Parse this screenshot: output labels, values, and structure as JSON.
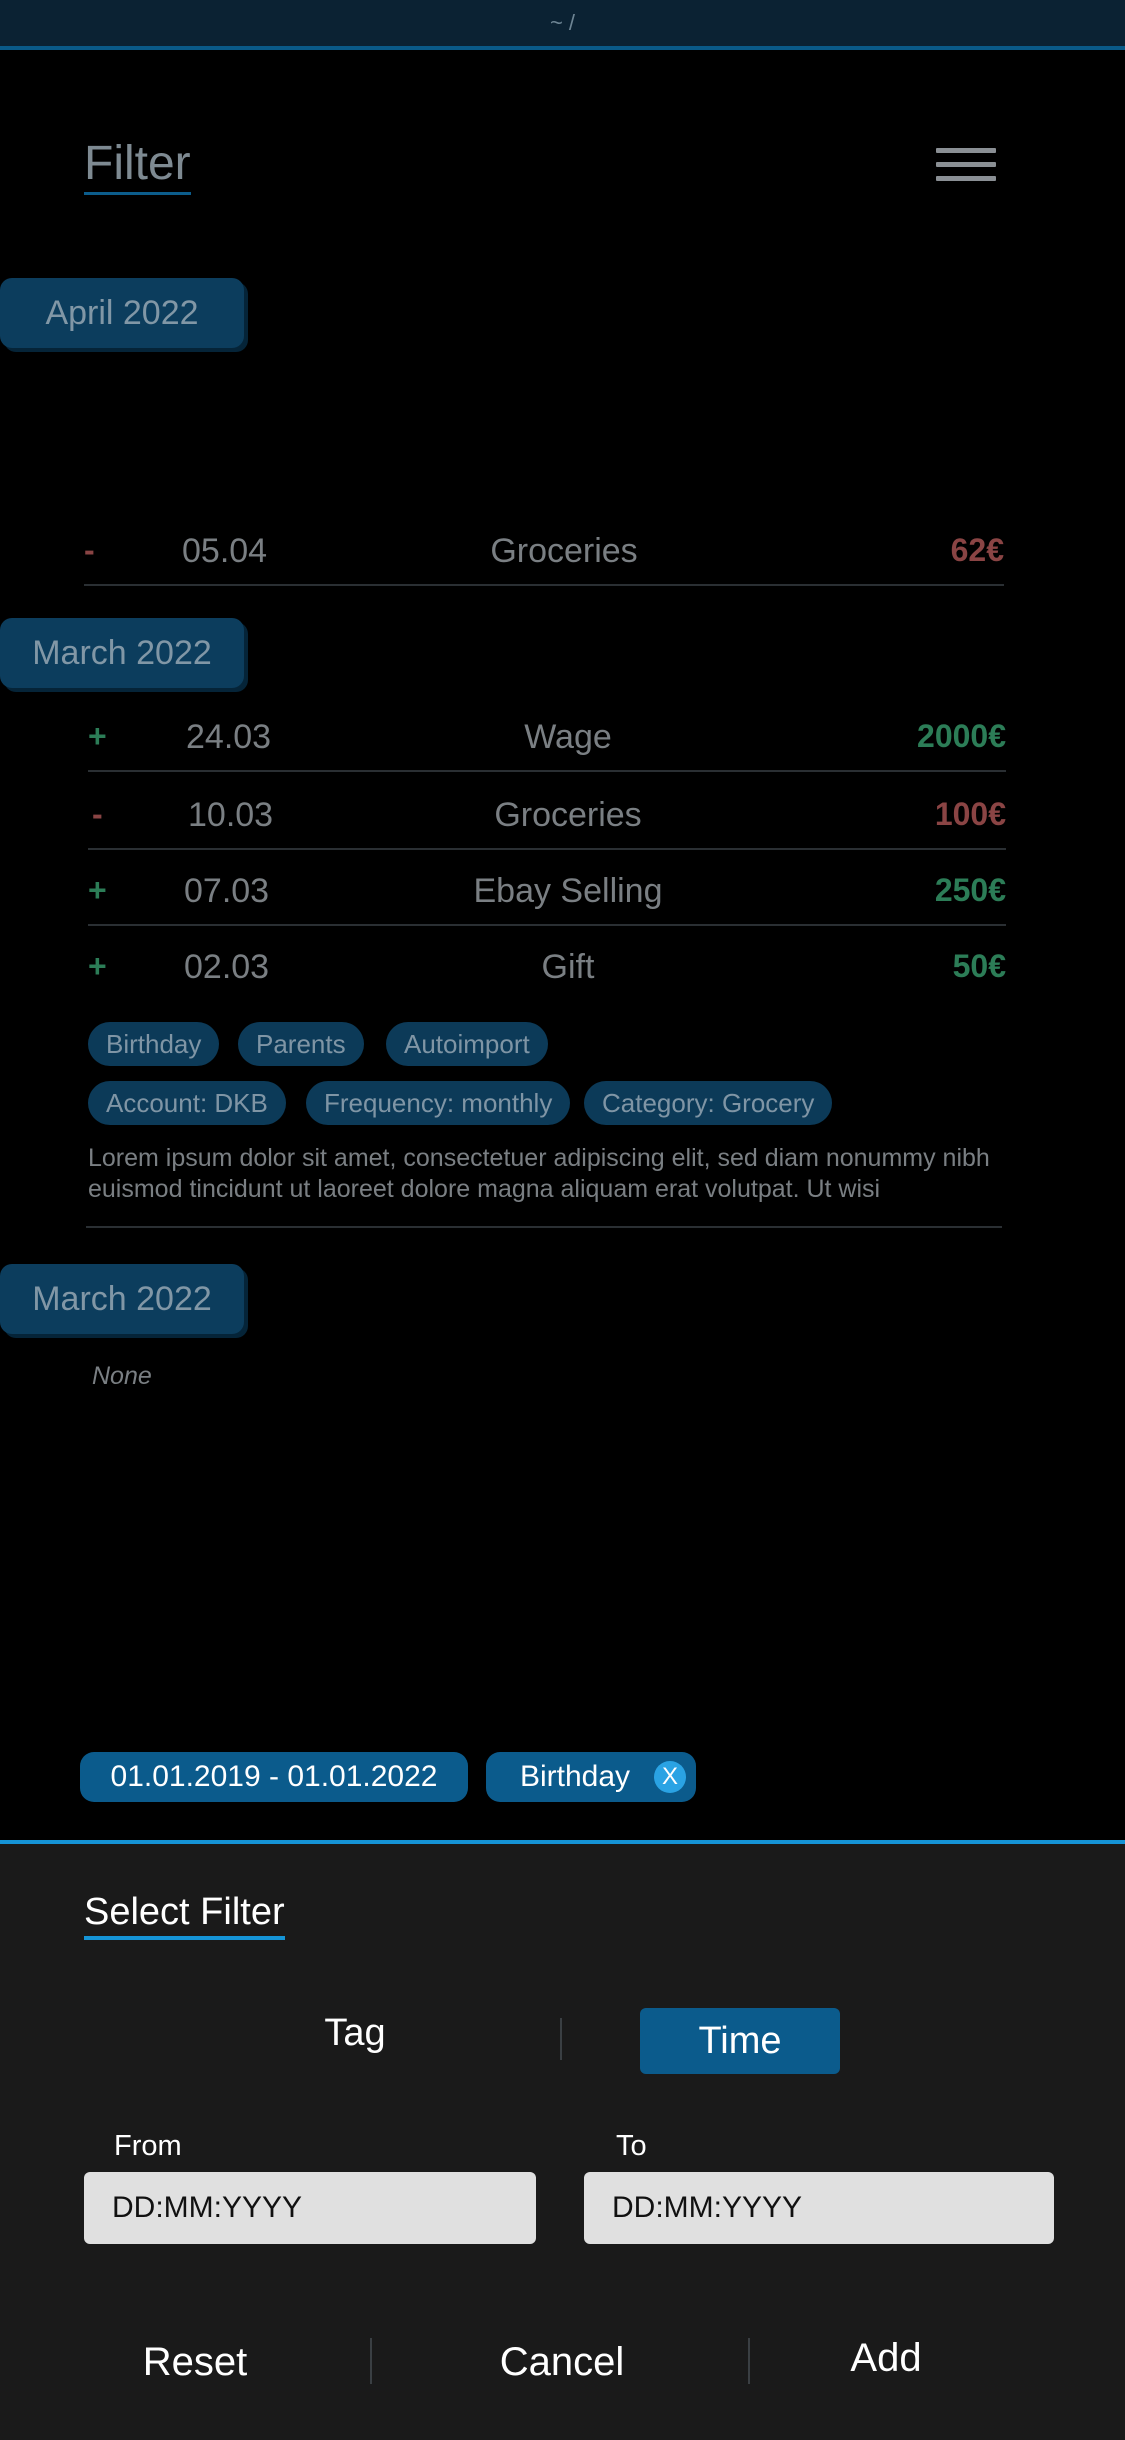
{
  "topbar": {
    "path": "~ /"
  },
  "header": {
    "title": "Filter",
    "menu_icon": "hamburger-icon"
  },
  "groups": [
    {
      "month": "April 2022",
      "transactions": [
        {
          "sign": "-",
          "date": "05.04",
          "label": "Groceries",
          "amount": "62€"
        }
      ]
    },
    {
      "month": "March 2022",
      "transactions": [
        {
          "sign": "+",
          "date": "24.03",
          "label": "Wage",
          "amount": "2000€"
        },
        {
          "sign": "-",
          "date": "10.03",
          "label": "Groceries",
          "amount": "100€"
        },
        {
          "sign": "+",
          "date": "07.03",
          "label": "Ebay Selling",
          "amount": "250€"
        },
        {
          "sign": "+",
          "date": "02.03",
          "label": "Gift",
          "amount": "50€"
        }
      ],
      "tags": [
        "Birthday",
        "Parents",
        "Autoimport"
      ],
      "attributes": [
        "Account: DKB",
        "Frequency: monthly",
        "Category: Grocery"
      ],
      "description": "Lorem ipsum dolor sit amet, consectetuer adipiscing elit, sed diam nonummy nibh euismod tincidunt ut laoreet dolore magna aliquam erat volutpat. Ut wisi"
    },
    {
      "month": "March 2022",
      "empty_text": "None"
    }
  ],
  "active_filters": [
    {
      "label": "01.01.2019 - 01.01.2022"
    },
    {
      "label": "Birthday",
      "remove_symbol": "X"
    }
  ],
  "sheet": {
    "title": "Select Filter",
    "tabs": {
      "tag": "Tag",
      "time": "Time"
    },
    "from_label": "From",
    "to_label": "To",
    "from_placeholder": "DD:MM:YYYY",
    "to_placeholder": "DD:MM:YYYY",
    "actions": {
      "reset": "Reset",
      "cancel": "Cancel",
      "add": "Add"
    }
  },
  "colors": {
    "accent": "#1594d6",
    "pill": "#0c3d5d",
    "positive": "#2c7d57",
    "negative": "#8a4444",
    "sheet_bg": "#1a1a1a"
  }
}
